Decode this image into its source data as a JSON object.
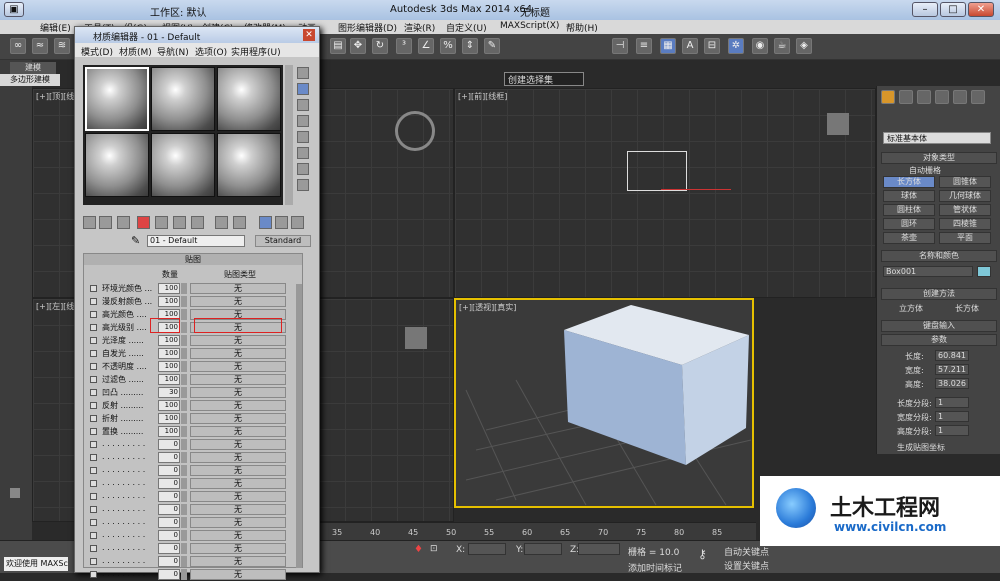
{
  "app": {
    "title": "Autodesk 3ds Max  2014 x64",
    "document": "无标题",
    "workspace": "工作区: 默认"
  },
  "menu": [
    "编辑(E)",
    "工具(T)",
    "组(G)",
    "视图(V)",
    "创建(C)",
    "修改器(M)",
    "动画",
    "图形编辑器(D)",
    "渲染(R)",
    "自定义(U)",
    "MAXScript(X)",
    "帮助(H)"
  ],
  "toolbar": {
    "selection_set": "创建选择集"
  },
  "left_panel": {
    "tab": "建模",
    "subtab": "多边形建模"
  },
  "viewports": {
    "top": "[+][顶][线框]",
    "front": "[+][前][线框]",
    "left": "[+][左][线框]",
    "perspective": "[+][透视][真实]"
  },
  "material_editor": {
    "title": "材质编辑器 - 01 - Default",
    "menu": [
      "模式(D)",
      "材质(M)",
      "导航(N)",
      "选项(O)",
      "实用程序(U)"
    ],
    "material_name": "01 - Default",
    "material_type": "Standard",
    "maps_section": "贴图",
    "col_amount": "数量",
    "col_maptype": "贴图类型",
    "maps": [
      {
        "label": "环境光颜色 ...",
        "amount": "100",
        "map": "无"
      },
      {
        "label": "漫反射颜色 ...",
        "amount": "100",
        "map": "无"
      },
      {
        "label": "高光颜色 ....",
        "amount": "100",
        "map": "无"
      },
      {
        "label": "高光级别 ....",
        "amount": "100",
        "map": "无"
      },
      {
        "label": "光泽度 ......",
        "amount": "100",
        "map": "无"
      },
      {
        "label": "自发光 ......",
        "amount": "100",
        "map": "无"
      },
      {
        "label": "不透明度 ....",
        "amount": "100",
        "map": "无"
      },
      {
        "label": "过滤色 ......",
        "amount": "100",
        "map": "无"
      },
      {
        "label": "凹凸 .........",
        "amount": "30",
        "map": "无"
      },
      {
        "label": "反射 .........",
        "amount": "100",
        "map": "无"
      },
      {
        "label": "折射 .........",
        "amount": "100",
        "map": "无"
      },
      {
        "label": "置换 .........",
        "amount": "100",
        "map": "无"
      },
      {
        "label": ". . . . . . . . .",
        "amount": "0",
        "map": "无"
      },
      {
        "label": ". . . . . . . . .",
        "amount": "0",
        "map": "无"
      },
      {
        "label": ". . . . . . . . .",
        "amount": "0",
        "map": "无"
      },
      {
        "label": ". . . . . . . . .",
        "amount": "0",
        "map": "无"
      },
      {
        "label": ". . . . . . . . .",
        "amount": "0",
        "map": "无"
      },
      {
        "label": ". . . . . . . . .",
        "amount": "0",
        "map": "无"
      },
      {
        "label": ". . . . . . . . .",
        "amount": "0",
        "map": "无"
      },
      {
        "label": ". . . . . . . . .",
        "amount": "0",
        "map": "无"
      },
      {
        "label": ". . . . . . . . .",
        "amount": "0",
        "map": "无"
      },
      {
        "label": ". . . . . . . . .",
        "amount": "0",
        "map": "无"
      },
      {
        "label": ". . . . . . . . .",
        "amount": "0",
        "map": "无"
      }
    ]
  },
  "command_panel": {
    "category": "标准基本体",
    "object_type": "对象类型",
    "autogrid": "自动栅格",
    "buttons": [
      "长方体",
      "圆锥体",
      "球体",
      "几何球体",
      "圆柱体",
      "管状体",
      "圆环",
      "四棱锥",
      "茶壶",
      "平面"
    ],
    "name_color": "名称和颜色",
    "object_name": "Box001",
    "create_method": "创建方法",
    "method_cube": "立方体",
    "method_box": "长方体",
    "keyboard_entry": "键盘输入",
    "params": "参数",
    "length_label": "长度:",
    "length": "60.841",
    "width_label": "宽度:",
    "width": "57.211",
    "height_label": "高度:",
    "height": "38.026",
    "lseg_label": "长度分段:",
    "lseg": "1",
    "wseg_label": "宽度分段:",
    "wseg": "1",
    "hseg_label": "高度分段:",
    "hseg": "1",
    "gen_map": "生成贴图坐标"
  },
  "timeline": [
    "35",
    "40",
    "45",
    "50",
    "55",
    "60",
    "65",
    "70",
    "75",
    "80",
    "85"
  ],
  "status": {
    "welcome": "欢迎使用 MAXSc",
    "x_label": "X:",
    "y_label": "Y:",
    "z_label": "Z:",
    "grid": "栅格 = 10.0",
    "auto_key": "自动关键点",
    "set_key": "设置关键点",
    "add_time_tag": "添加时间标记"
  },
  "watermark": {
    "brand": "土木工程网",
    "url": "www.civilcn.com"
  }
}
